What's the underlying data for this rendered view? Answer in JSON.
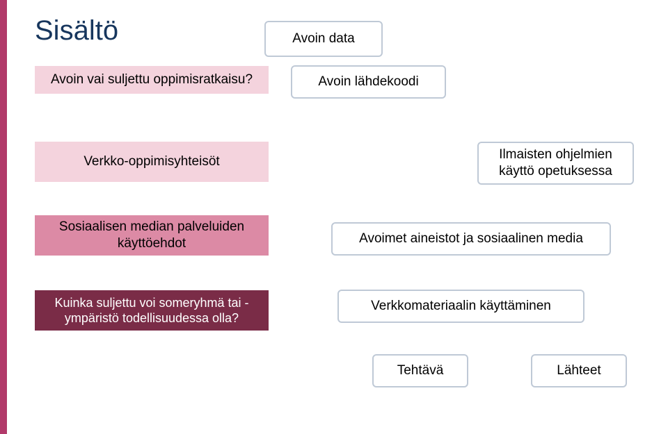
{
  "title": "Sisältö",
  "boxes": {
    "avoin_data": "Avoin data",
    "avoin_lahdekoodi": "Avoin lähdekoodi",
    "avoin_vai_suljettu": "Avoin vai suljettu oppimisratkaisu?",
    "verkko_oppimis": "Verkko-oppimisyhteisöt",
    "ilmaisten": "Ilmaisten ohjelmien käyttö opetuksessa",
    "sosiaalisen_median": "Sosiaalisen median palveluiden käyttöehdot",
    "avoimet_aineistot": "Avoimet aineistot ja sosiaalinen media",
    "kuinka_suljettu": "Kuinka suljettu voi someryhmä tai -ympäristö todellisuudessa olla?",
    "verkkomateriaalin": "Verkkomateriaalin käyttäminen",
    "tehtava": "Tehtävä",
    "lahteet": "Lähteet"
  }
}
